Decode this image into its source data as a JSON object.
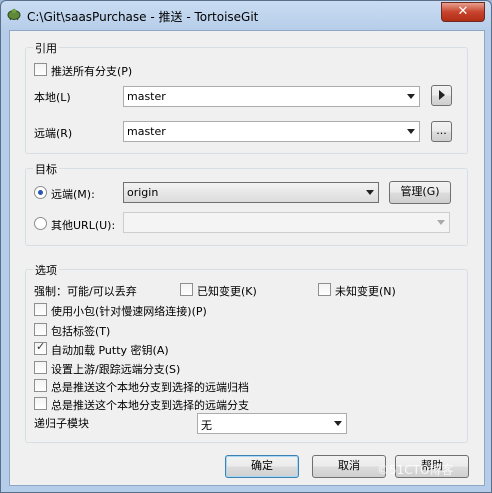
{
  "window": {
    "title": "C:\\Git\\saasPurchase - 推送 - TortoiseGit",
    "close_label": "✕"
  },
  "refs": {
    "title": "引用",
    "push_all_branches": "推送所有分支(P)",
    "local_label": "本地(L)",
    "local_value": "master",
    "remote_label": "远端(R)",
    "remote_value": "master",
    "ellipsis": "..."
  },
  "target": {
    "title": "目标",
    "remote_label": "远端(M):",
    "remote_value": "origin",
    "manage_label": "管理(G)",
    "other_url_label": "其他URL(U):",
    "other_url_value": ""
  },
  "options": {
    "title": "选项",
    "force_label": "强制：可能/可以丢弃",
    "known_changes": "已知变更(K)",
    "unknown_changes": "未知变更(N)",
    "thin_pack": "使用小包(针对慢速网络连接)(P)",
    "include_tags": "包括标签(T)",
    "autoload_putty": "自动加载 Putty 密钥(A)",
    "set_upstream": "设置上游/跟踪远端分支(S)",
    "push_to_archive": "总是推送这个本地分支到选择的远端归档",
    "push_to_branch": "总是推送这个本地分支到选择的远端分支",
    "recurse_label": "递归子模块",
    "recurse_value": "无"
  },
  "buttons": {
    "ok": "确定",
    "cancel": "取消",
    "help": "帮助"
  },
  "watermark": "©51CTO博客"
}
